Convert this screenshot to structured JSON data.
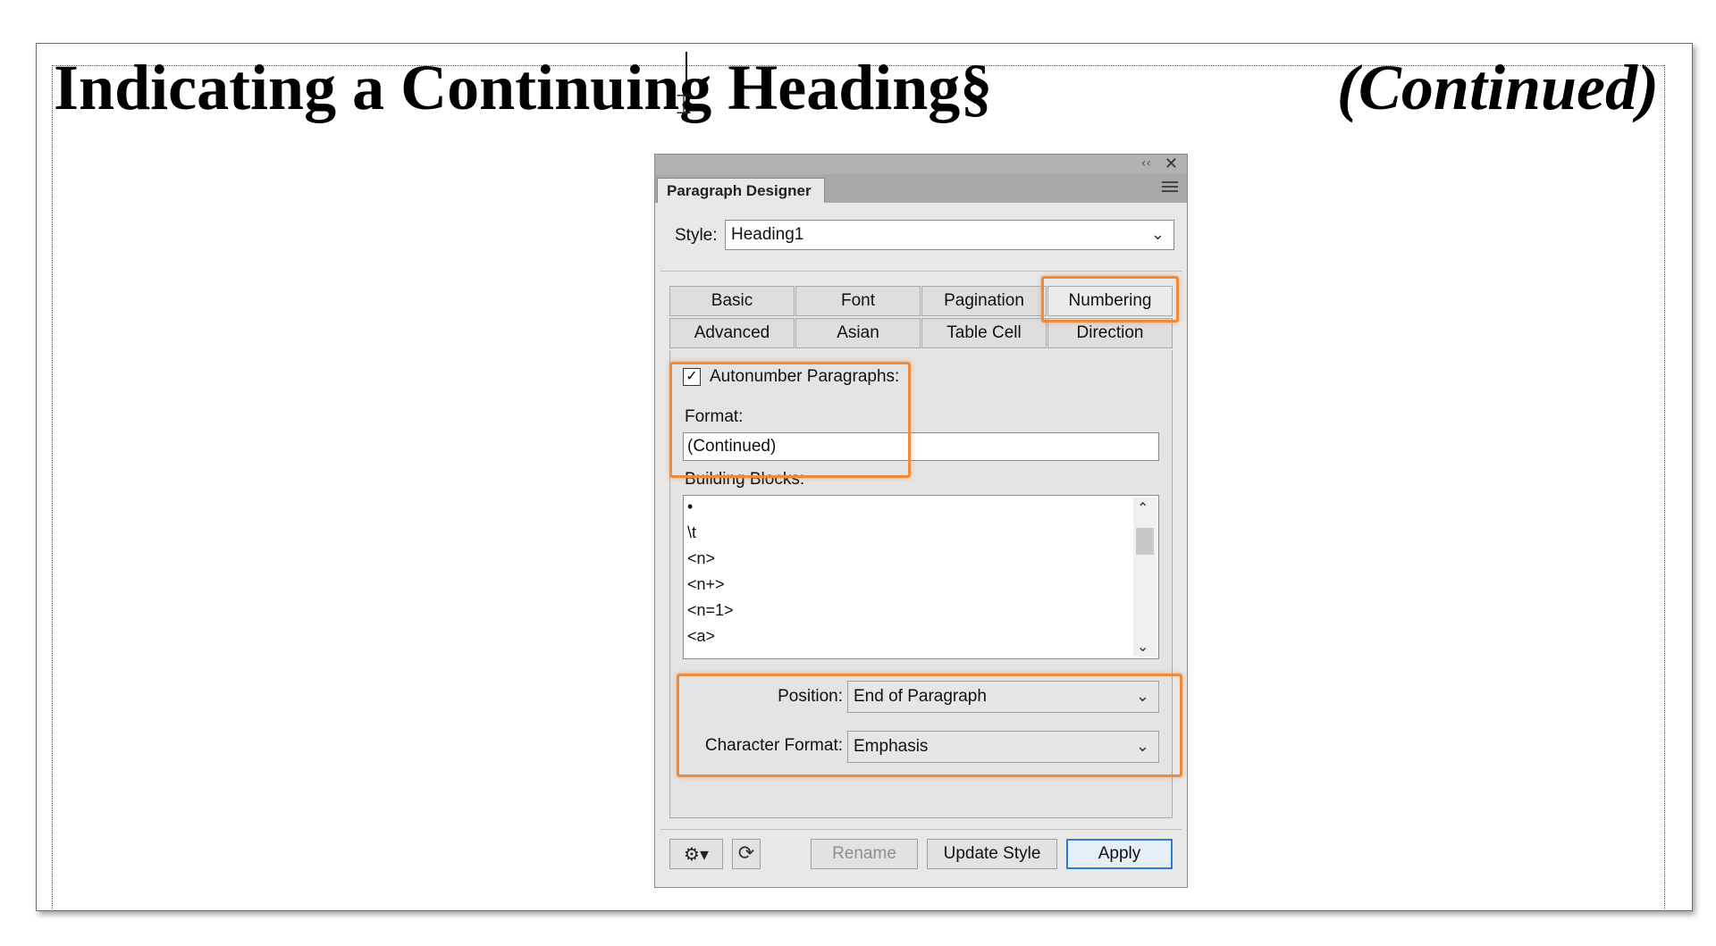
{
  "document": {
    "heading": "Indicating a Continuing Heading§",
    "autonumber_text": "(Continued)"
  },
  "panel": {
    "title": "Paragraph Designer",
    "collapse_glyph": "‹‹",
    "close_glyph": "✕",
    "style_label": "Style:",
    "style_value": "Heading1",
    "tabs": [
      "Basic",
      "Font",
      "Pagination",
      "Numbering",
      "Advanced",
      "Asian",
      "Table Cell",
      "Direction"
    ],
    "active_tab": "Numbering",
    "autonumber_checked": true,
    "autonumber_label": "Autonumber Paragraphs:",
    "format_label": "Format:",
    "format_value": "(Continued)",
    "building_blocks_label": "Building Blocks:",
    "building_blocks": [
      "•",
      "\\t",
      "<n>",
      "<n+>",
      "<n=1>",
      "<a>"
    ],
    "position_label": "Position:",
    "position_value": "End of Paragraph",
    "char_format_label": "Character Format:",
    "char_format_value": "Emphasis",
    "buttons": {
      "rename": "Rename",
      "update_style": "Update Style",
      "apply": "Apply"
    }
  },
  "colors": {
    "highlight": "#ed8a3c",
    "apply_border": "#2f7bd8"
  },
  "icons": [
    "gear-icon",
    "refresh-icon",
    "chevron-down-icon",
    "close-icon",
    "panel-menu-icon",
    "collapse-icon",
    "scroll-up-icon",
    "scroll-down-icon",
    "checkbox-check-icon"
  ]
}
